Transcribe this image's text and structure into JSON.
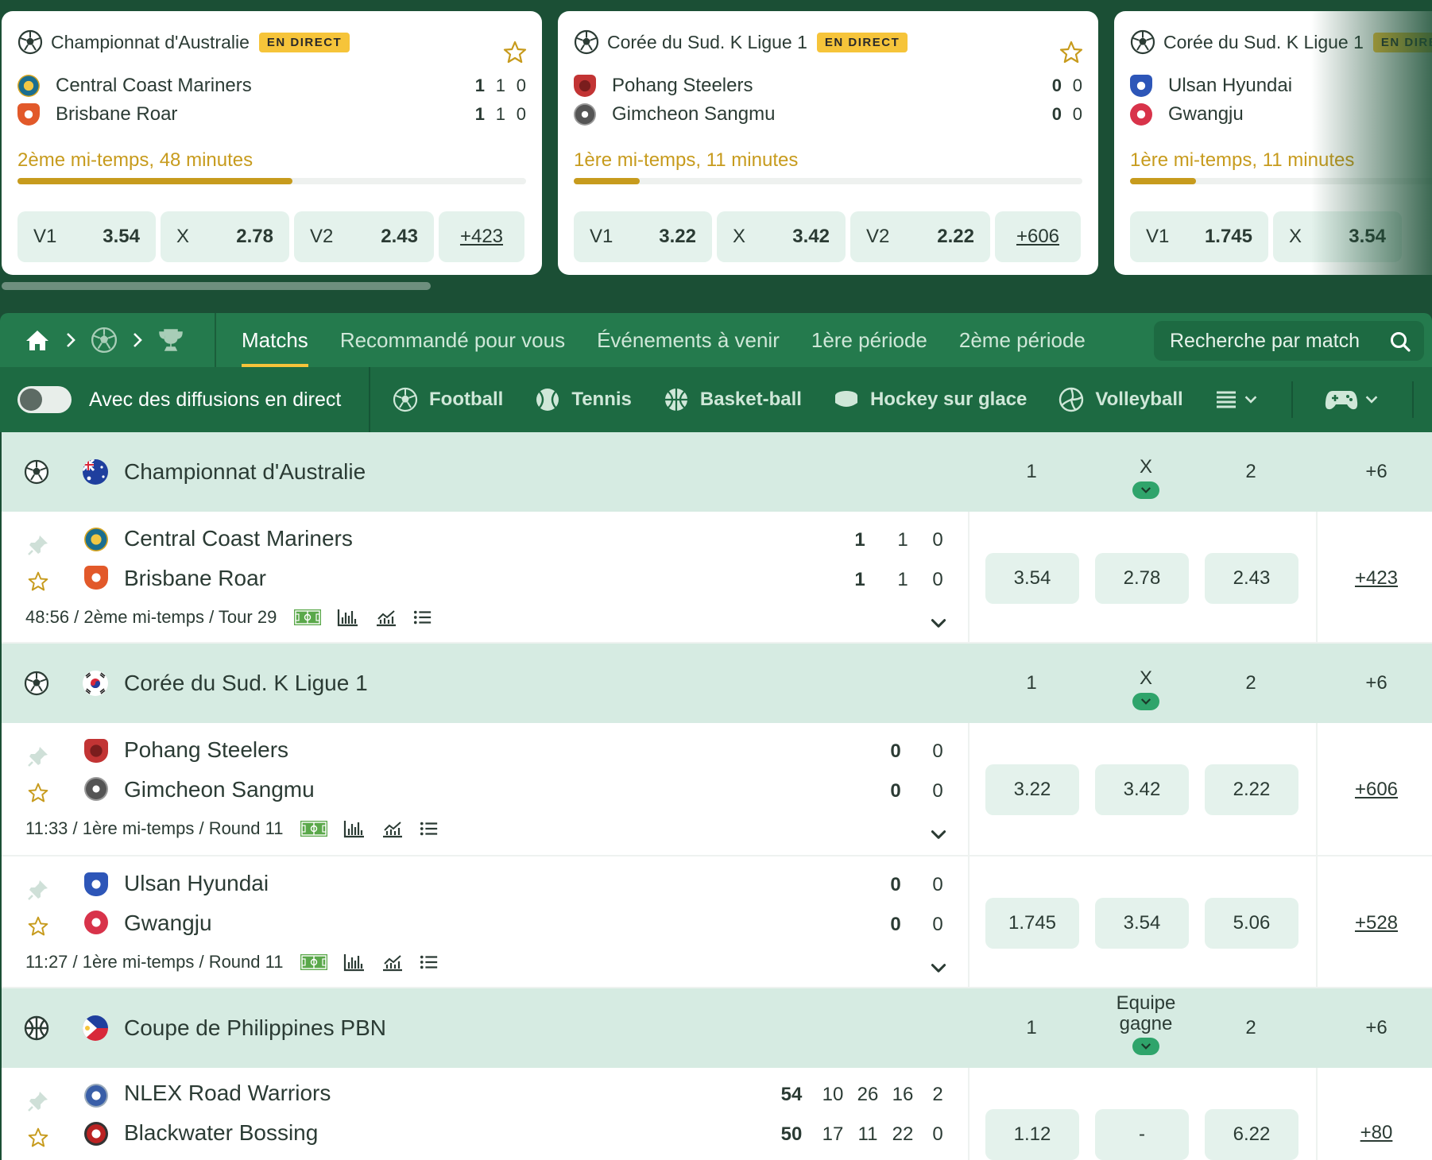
{
  "live_badge": "EN DIRECT",
  "cards": [
    {
      "league": "Championnat d'Australie",
      "team1": "Central Coast Mariners",
      "team1_scores": [
        "1",
        "1",
        "0"
      ],
      "team2": "Brisbane Roar",
      "team2_scores": [
        "1",
        "1",
        "0"
      ],
      "status": "2ème mi-temps, 48 minutes",
      "progress": 0.54,
      "odds": [
        {
          "label": "V1",
          "value": "3.54"
        },
        {
          "label": "X",
          "value": "2.78"
        },
        {
          "label": "V2",
          "value": "2.43"
        }
      ],
      "more": "+423"
    },
    {
      "league": "Corée du Sud. K Ligue 1",
      "team1": "Pohang Steelers",
      "team1_scores": [
        "0",
        "0"
      ],
      "team2": "Gimcheon Sangmu",
      "team2_scores": [
        "0",
        "0"
      ],
      "status": "1ère mi-temps, 11 minutes",
      "progress": 0.13,
      "odds": [
        {
          "label": "V1",
          "value": "3.22"
        },
        {
          "label": "X",
          "value": "3.42"
        },
        {
          "label": "V2",
          "value": "2.22"
        }
      ],
      "more": "+606"
    },
    {
      "league": "Corée du Sud. K Ligue 1",
      "team1": "Ulsan Hyundai",
      "team1_scores": [
        "",
        ""
      ],
      "team2": "Gwangju",
      "team2_scores": [
        "",
        ""
      ],
      "status": "1ère mi-temps, 11 minutes",
      "progress": 0.13,
      "odds": [
        {
          "label": "V1",
          "value": "1.745"
        },
        {
          "label": "X",
          "value": "3.54"
        }
      ],
      "more": ""
    }
  ],
  "nav": {
    "tabs": [
      "Matchs",
      "Recommandé pour vous",
      "Événements à venir",
      "1ère période",
      "2ème période"
    ],
    "search_placeholder": "Recherche par match"
  },
  "filters": {
    "live_toggle_label": "Avec des diffusions en direct",
    "sports": [
      "Football",
      "Tennis",
      "Basket-ball",
      "Hockey sur glace",
      "Volleyball"
    ]
  },
  "leagues": [
    {
      "name": "Championnat d'Australie",
      "cols": [
        "1",
        "X",
        "2",
        "+6"
      ],
      "events": [
        {
          "team1": "Central Coast Mariners",
          "team2": "Brisbane Roar",
          "scores1": [
            "1",
            "1",
            "0"
          ],
          "scores2": [
            "1",
            "1",
            "0"
          ],
          "meta": "48:56 / 2ème mi-temps / Tour 29",
          "odds": [
            "3.54",
            "2.78",
            "2.43"
          ],
          "more": "+423"
        }
      ]
    },
    {
      "name": "Corée du Sud. K Ligue 1",
      "cols": [
        "1",
        "X",
        "2",
        "+6"
      ],
      "events": [
        {
          "team1": "Pohang Steelers",
          "team2": "Gimcheon Sangmu",
          "scores1": [
            "0",
            "0"
          ],
          "scores2": [
            "0",
            "0"
          ],
          "meta": "11:33 / 1ère mi-temps / Round 11",
          "odds": [
            "3.22",
            "3.42",
            "2.22"
          ],
          "more": "+606"
        },
        {
          "team1": "Ulsan Hyundai",
          "team2": "Gwangju",
          "scores1": [
            "0",
            "0"
          ],
          "scores2": [
            "0",
            "0"
          ],
          "meta": "11:27 / 1ère mi-temps / Round 11",
          "odds": [
            "1.745",
            "3.54",
            "5.06"
          ],
          "more": "+528"
        }
      ]
    },
    {
      "name": "Coupe de Philippines PBN",
      "cols": [
        "1",
        "Equipe gagne",
        "2",
        "+6"
      ],
      "events": [
        {
          "team1": "NLEX Road Warriors",
          "team2": "Blackwater Bossing",
          "scores1": [
            "54",
            "10",
            "26",
            "16",
            "2"
          ],
          "scores2": [
            "50",
            "17",
            "11",
            "22",
            "0"
          ],
          "meta": "",
          "odds": [
            "1.12",
            "-",
            "6.22"
          ],
          "more": "+80"
        }
      ]
    }
  ],
  "colors": {
    "dark_green": "#1b4f35",
    "nav_green": "#247a4d",
    "gold": "#c79b1d",
    "badge": "#f6c43a",
    "odds_bg": "#e4f2ec",
    "league_bg": "#d6ebe2"
  }
}
